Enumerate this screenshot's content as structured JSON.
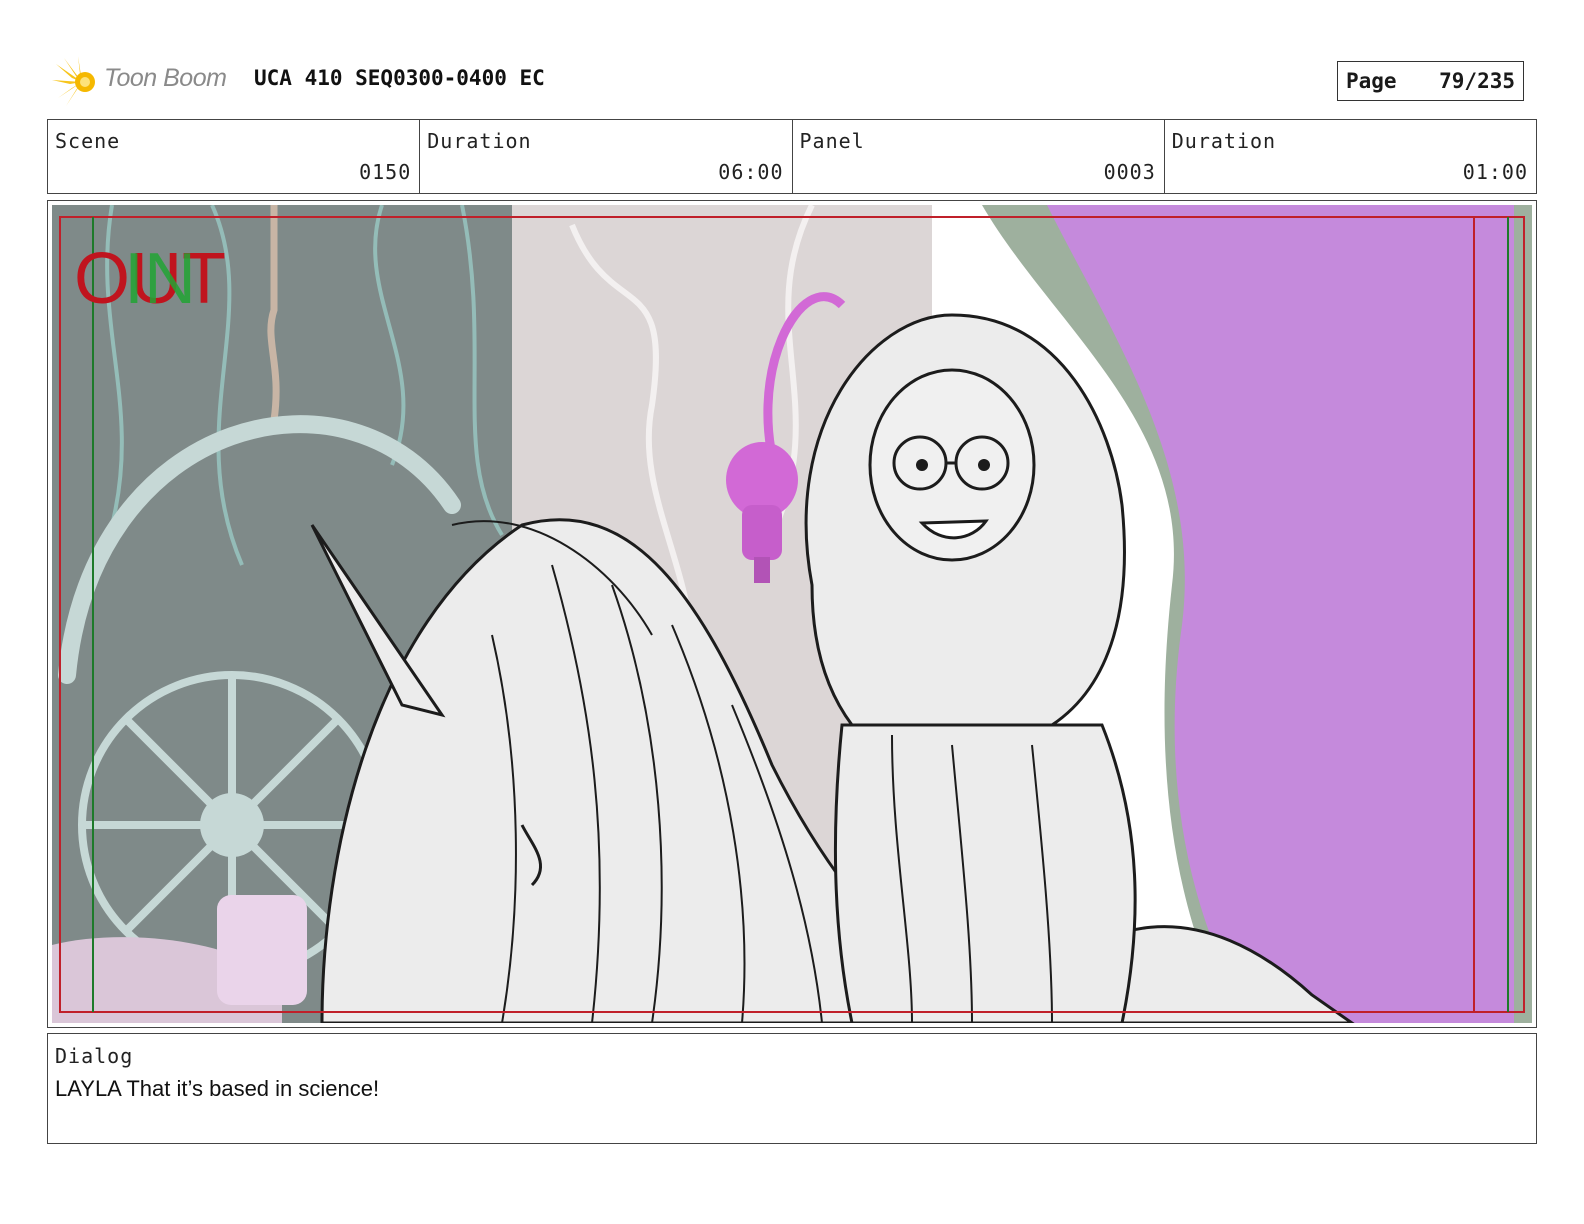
{
  "header": {
    "logo_text": "Toon Boom",
    "title": "UCA 410 SEQ0300-0400 EC",
    "page_label": "Page",
    "page_value": "79/235"
  },
  "info": {
    "scene_label": "Scene",
    "scene_value": "0150",
    "scene_duration_label": "Duration",
    "scene_duration_value": "06:00",
    "panel_label": "Panel",
    "panel_value": "0003",
    "panel_duration_label": "Duration",
    "panel_duration_value": "01:00"
  },
  "panel_overlay": {
    "out_text": "OUT",
    "in_text": "IN"
  },
  "dialog": {
    "label": "Dialog",
    "text": "LAYLA That it’s based in science!"
  }
}
